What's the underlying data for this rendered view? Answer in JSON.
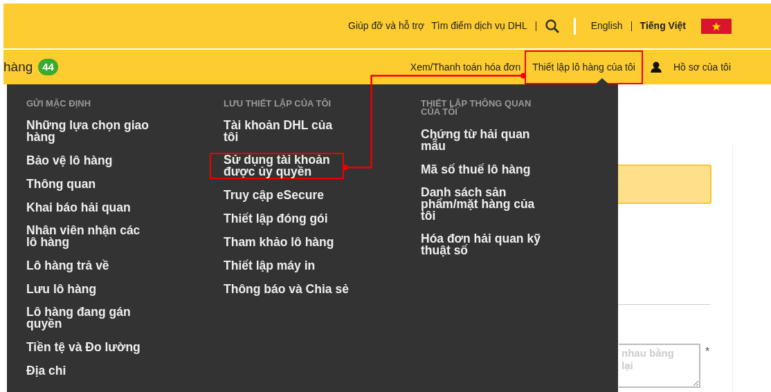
{
  "top_bar": {
    "links": [
      "Giúp đỡ và hỗ trợ",
      "Tìm điểm dịch vụ DHL"
    ],
    "languages": [
      {
        "label": "English",
        "selected": false
      },
      {
        "label": "Tiếng Việt",
        "selected": true
      }
    ]
  },
  "nav_bar": {
    "left_text": "hàng",
    "badge": "44",
    "links": [
      {
        "label": "Xem/Thanh toán hóa đơn",
        "highlighted": false
      },
      {
        "label": "Thiết lập lô hàng của tôi",
        "highlighted": true
      },
      {
        "label": "Hồ sơ của tôi",
        "highlighted": false
      }
    ]
  },
  "menu": {
    "columns": [
      {
        "heading": "GỬI MẶC ĐỊNH",
        "items": [
          {
            "label": "Những lựa chọn giao\nhàng",
            "highlighted": false
          },
          {
            "label": "Bảo vệ lô hàng",
            "highlighted": false
          },
          {
            "label": "Thông quan",
            "highlighted": false
          },
          {
            "label": "Khai báo hải quan",
            "highlighted": false
          },
          {
            "label": "Nhân viên nhận các\nlô hàng",
            "highlighted": false
          },
          {
            "label": "Lô hàng trả về",
            "highlighted": false
          },
          {
            "label": "Lưu lô hàng",
            "highlighted": false
          },
          {
            "label": "Lô hàng đang gán\nquyền",
            "highlighted": false
          },
          {
            "label": "Tiền tệ và Đo lường",
            "highlighted": false
          },
          {
            "label": "Địa chỉ",
            "highlighted": false
          }
        ]
      },
      {
        "heading": "LƯU THIẾT LẬP CỦA TÔI",
        "items": [
          {
            "label": "Tài khoản DHL của\ntôi",
            "highlighted": false
          },
          {
            "label": "Sử dụng tài khoản\nđược ủy quyền",
            "highlighted": true
          },
          {
            "label": "Truy cập eSecure",
            "highlighted": false
          },
          {
            "label": "Thiết lập đóng gói",
            "highlighted": false
          },
          {
            "label": "Tham khảo lô hàng",
            "highlighted": false
          },
          {
            "label": "Thiết lập máy in",
            "highlighted": false
          },
          {
            "label": "Thông báo và Chia sẻ",
            "highlighted": false
          }
        ]
      },
      {
        "heading": "THIẾT LẬP THÔNG QUAN\nCỦA TÔI",
        "items": [
          {
            "label": "Chứng từ hải quan\nmẫu",
            "highlighted": false
          },
          {
            "label": "Mã số thuế lô hàng",
            "highlighted": false
          },
          {
            "label": "Danh sách sản\nphẩm/mặt hàng của\ntôi",
            "highlighted": false
          },
          {
            "label": "Hóa đơn hải quan kỹ\nthuật số",
            "highlighted": false
          }
        ]
      }
    ]
  },
  "content": {
    "textarea": {
      "placeholder": "nhau bằng\nlại"
    },
    "required_mark": "*"
  }
}
